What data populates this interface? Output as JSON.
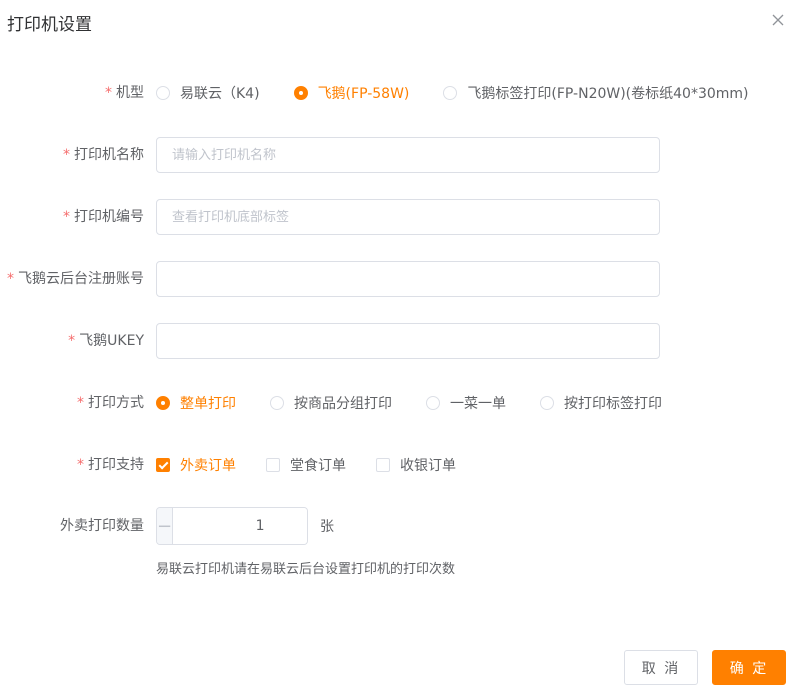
{
  "dialog": {
    "title": "打印机设置"
  },
  "form": {
    "model": {
      "label": "机型",
      "options": [
        "易联云（K4)",
        "飞鹅(FP-58W)",
        "飞鹅标签打印(FP-N20W)(卷标纸40*30mm)"
      ],
      "selected": "飞鹅(FP-58W)"
    },
    "printer_name": {
      "label": "打印机名称",
      "value": "",
      "placeholder": "请输入打印机名称"
    },
    "printer_sn": {
      "label": "打印机编号",
      "value": "",
      "placeholder": "查看打印机底部标签"
    },
    "account": {
      "label": "飞鹅云后台注册账号",
      "value": "",
      "placeholder": ""
    },
    "ukey": {
      "label": "飞鹅UKEY",
      "value": "",
      "placeholder": ""
    },
    "print_mode": {
      "label": "打印方式",
      "options": [
        "整单打印",
        "按商品分组打印",
        "一菜一单",
        "按打印标签打印"
      ],
      "selected": "整单打印"
    },
    "print_support": {
      "label": "打印支持",
      "options": [
        "外卖订单",
        "堂食订单",
        "收银订单"
      ],
      "checked": [
        "外卖订单"
      ]
    },
    "print_count": {
      "label": "外卖打印数量",
      "value": "1",
      "unit": "张",
      "hint": "易联云打印机请在易联云后台设置打印机的打印次数"
    }
  },
  "footer": {
    "cancel_label": "取 消",
    "confirm_label": "确 定"
  },
  "colors": {
    "accent": "#ff8000",
    "required": "#f56c6c",
    "border": "#dcdfe6"
  }
}
